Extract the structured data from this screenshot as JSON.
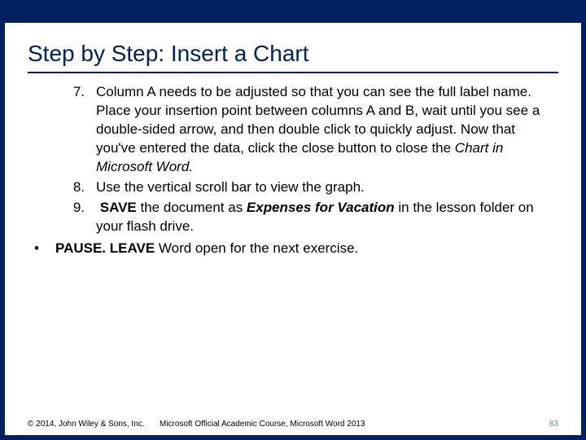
{
  "title": "Step by Step: Insert a Chart",
  "steps": [
    {
      "num": "7.",
      "html": "Column A needs to be adjusted so that you can see the full label name. Place your insertion point between columns A and B, wait until you see a double-sided arrow, and then double click to quickly adjust. Now that you've entered the data, click the close button to close the <i>Chart in Microsoft Word.</i>"
    },
    {
      "num": "8.",
      "html": "Use the vertical scroll bar to view the graph."
    },
    {
      "num": "9.",
      "html": "&nbsp;<b>SAVE</b> the document as <b><i>Expenses for Vacation</i></b> in the lesson folder on your flash drive."
    }
  ],
  "bullet": {
    "html": "<b>PAUSE. LEAVE</b> Word open for the next exercise."
  },
  "footer": {
    "copyright": "© 2014, John Wiley & Sons, Inc.",
    "course": "Microsoft Official Academic Course, Microsoft Word 2013",
    "page": "83"
  }
}
